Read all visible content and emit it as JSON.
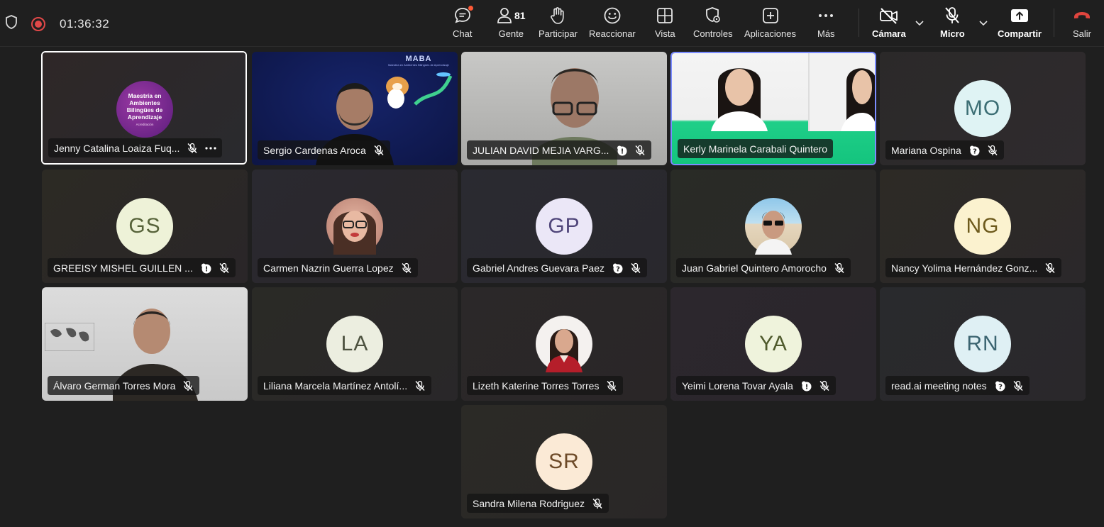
{
  "meeting": {
    "timer": "01:36:32"
  },
  "toolbar": {
    "chat": "Chat",
    "people": "Gente",
    "people_count": "81",
    "participate": "Participar",
    "react": "Reaccionar",
    "view": "Vista",
    "controls": "Controles",
    "apps": "Aplicaciones",
    "more": "Más",
    "camera": "Cámara",
    "mic": "Micro",
    "share": "Compartir",
    "leave": "Salir"
  },
  "colors": {
    "recording": "#e04848",
    "leave": "#e0453e",
    "notification": "#ff5a36",
    "active_border": "#ffffff",
    "spotlight_border": "#7b8cff"
  },
  "tiles": [
    {
      "name": "Jenny Catalina Loaiza Fuq...",
      "content": "Maestría en Ambientes Bilingües de Aprendizaje",
      "badge_sub": "Acreditación"
    },
    {
      "name": "Sergio Cardenas Aroca",
      "banner_title": "MABA",
      "banner_sub": "Maestría en Ambientes Bilingües de Aprendizaje"
    },
    {
      "name": "JULIAN DAVID MEJIA VARG..."
    },
    {
      "name": "Kerly Marinela Carabali Quintero"
    },
    {
      "name": "Mariana Ospina",
      "initials": "MO"
    },
    {
      "name": "GREEISY MISHEL GUILLEN ...",
      "initials": "GS"
    },
    {
      "name": "Carmen Nazrin Guerra Lopez"
    },
    {
      "name": "Gabriel Andres Guevara Paez",
      "initials": "GP"
    },
    {
      "name": "Juan Gabriel Quintero Amorocho"
    },
    {
      "name": "Nancy Yolima Hernández Gonz...",
      "initials": "NG"
    },
    {
      "name": "Álvaro German Torres Mora"
    },
    {
      "name": "Liliana Marcela Martínez Antolí...",
      "initials": "LA"
    },
    {
      "name": "Lizeth Katerine Torres Torres"
    },
    {
      "name": "Yeimi Lorena Tovar Ayala",
      "initials": "YA"
    },
    {
      "name": "read.ai meeting notes",
      "initials": "RN"
    },
    {
      "name": "Sandra Milena Rodriguez",
      "initials": "SR"
    }
  ]
}
